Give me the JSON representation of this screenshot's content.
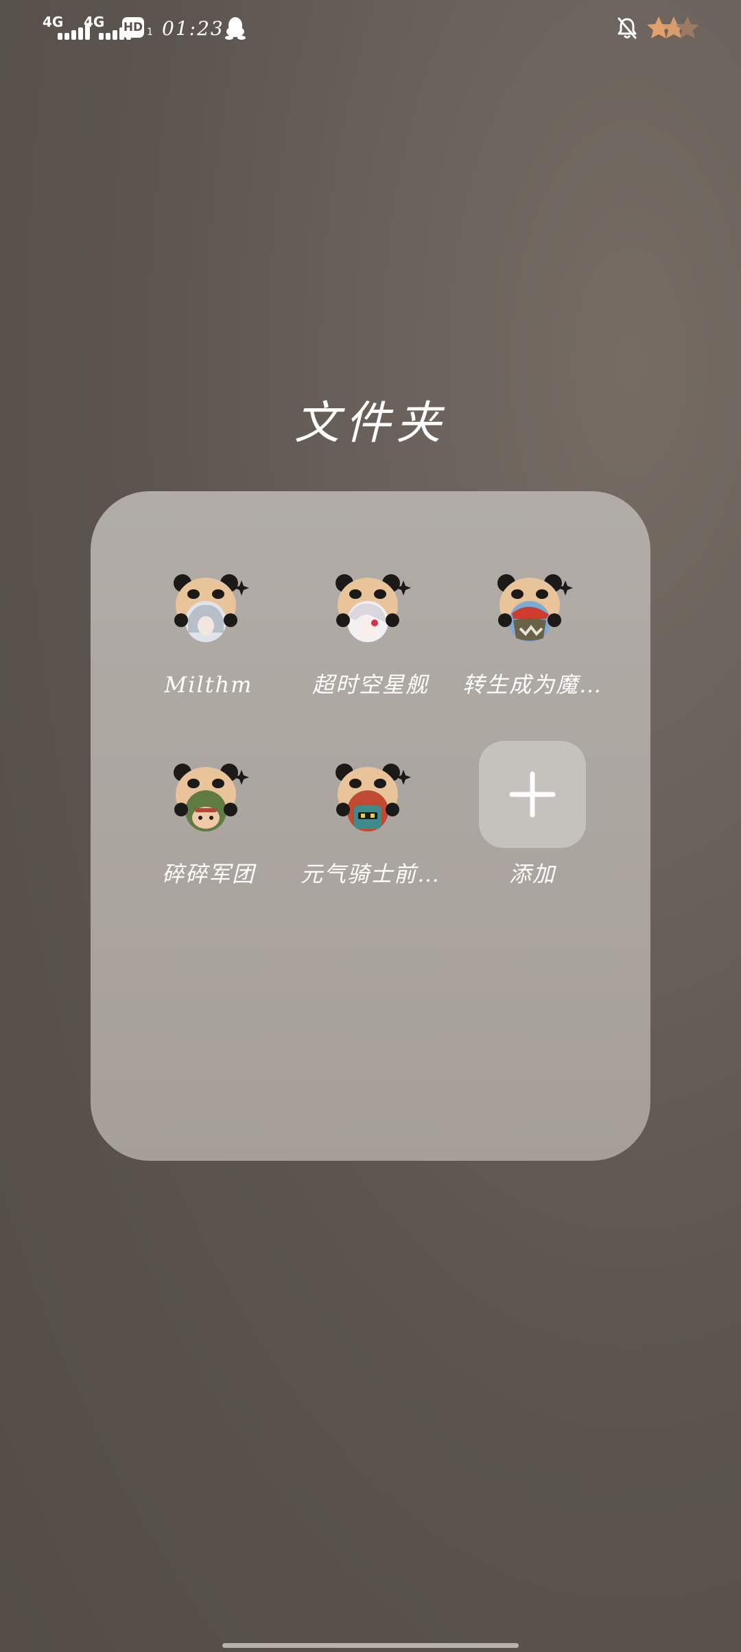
{
  "status_bar": {
    "sim1_network": "4G",
    "sim2_network": "4G",
    "hd_badge": "HD",
    "hd_sub": "1",
    "time": "01:23",
    "icons": [
      "signal-bars-icon",
      "hd-voice-icon",
      "qq-penguin-icon",
      "notifications-off-icon",
      "battery-icon"
    ]
  },
  "folder": {
    "title": "文件夹",
    "apps": [
      {
        "label": "Milthm",
        "icon": "milthm-app-icon"
      },
      {
        "label": "超时空星舰",
        "icon": "chaoshikong-xingjian-app-icon"
      },
      {
        "label": "转生成为魔…",
        "icon": "zhuansheng-chengwei-mo-app-icon"
      },
      {
        "label": "碎碎军团",
        "icon": "suisui-juntuan-app-icon"
      },
      {
        "label": "元气骑士前…",
        "icon": "yuanqi-qishi-qian-app-icon"
      }
    ],
    "add_button": {
      "label": "添加",
      "icon": "plus-icon"
    }
  },
  "colors": {
    "panda_fur": "#e9c49a",
    "panda_black": "#1c1a19",
    "folder_panel": "#aca6a1",
    "wallpaper": "#5c554f"
  }
}
